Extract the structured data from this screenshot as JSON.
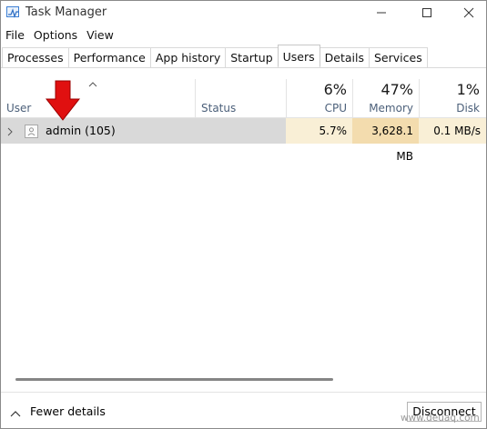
{
  "window": {
    "title": "Task Manager"
  },
  "menu": [
    "File",
    "Options",
    "View"
  ],
  "tabs": [
    {
      "label": "Processes",
      "active": false
    },
    {
      "label": "Performance",
      "active": false
    },
    {
      "label": "App history",
      "active": false
    },
    {
      "label": "Startup",
      "active": false
    },
    {
      "label": "Users",
      "active": true
    },
    {
      "label": "Details",
      "active": false
    },
    {
      "label": "Services",
      "active": false
    }
  ],
  "columns": {
    "user": {
      "label": "User"
    },
    "status": {
      "label": "Status"
    },
    "cpu": {
      "label": "CPU",
      "percent": "6%"
    },
    "memory": {
      "label": "Memory",
      "percent": "47%"
    },
    "disk": {
      "label": "Disk",
      "percent": "1%"
    }
  },
  "rows": [
    {
      "user": "admin (105)",
      "status": "",
      "cpu": "5.7%",
      "memory": "3,628.1 MB",
      "disk": "0.1 MB/s"
    }
  ],
  "heat_colors": {
    "cpu": "#f9efd6",
    "memory": "#f3dcae",
    "disk": "#f9efd6"
  },
  "footer": {
    "fewer_details": "Fewer details",
    "disconnect": "Disconnect"
  },
  "watermark": "www.deuaq.com",
  "annotation": {
    "arrow_color": "#e01010"
  }
}
